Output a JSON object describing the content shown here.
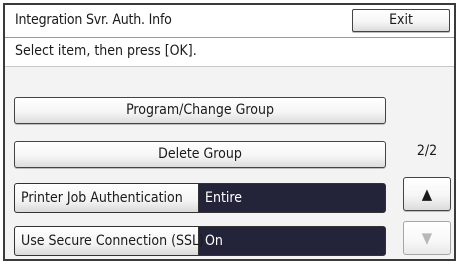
{
  "header": {
    "title": "Integration Svr. Auth. Info",
    "exit_label": "Exit"
  },
  "instruction": "Select item, then press [OK].",
  "buttons": {
    "program_change_group": "Program/Change Group",
    "delete_group": "Delete Group"
  },
  "settings": [
    {
      "label": "Printer Job Authentication",
      "value": "Entire"
    },
    {
      "label": "Use Secure Connection (SSL)",
      "value": "On"
    }
  ],
  "pagination": {
    "page_indicator": "2/2",
    "up_icon": "triangle-up",
    "down_icon": "triangle-down",
    "down_enabled": false
  },
  "colors": {
    "value_background": "#23233a",
    "disabled_text": "#b8b8b8"
  }
}
